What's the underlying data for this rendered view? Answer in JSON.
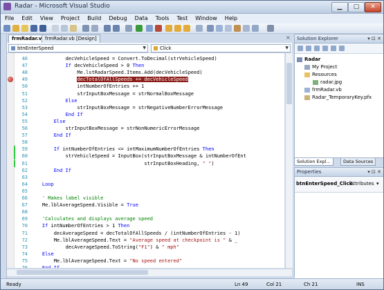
{
  "window": {
    "title": "Radar - Microsoft Visual Studio",
    "minimize": "▁",
    "maximize": "▢",
    "close": "✕"
  },
  "menu": [
    "File",
    "Edit",
    "View",
    "Project",
    "Build",
    "Debug",
    "Data",
    "Tools",
    "Test",
    "Window",
    "Help"
  ],
  "tabs": {
    "active": "frmRadar.vb",
    "inactive": "frmRadar.vb [Design]",
    "close": "×"
  },
  "dropdowns": {
    "object": "btnEnterSpeed",
    "event": "Click"
  },
  "code_lines": [
    {
      "n": "46",
      "parts": [
        {
          "t": "            decVehicleSpeed = Convert.ToDecimal(strVehicleSpeed)"
        }
      ]
    },
    {
      "n": "47",
      "parts": [
        {
          "t": "            ",
          "c": ""
        },
        {
          "t": "If",
          "c": "kw"
        },
        {
          "t": " decVehicleSpeed > 0 "
        },
        {
          "t": "Then",
          "c": "kw"
        }
      ]
    },
    {
      "n": "48",
      "parts": [
        {
          "t": "                Me.lstRadarSpeed.Items.Add(decVehicleSpeed)"
        }
      ]
    },
    {
      "n": "49",
      "parts": [
        {
          "t": "                "
        },
        {
          "t": "decTotalOfAllSpeeds += decVehicleSpeed",
          "c": "bpline"
        }
      ]
    },
    {
      "n": "50",
      "parts": [
        {
          "t": "                intNumberOfEntries += 1"
        }
      ]
    },
    {
      "n": "51",
      "parts": [
        {
          "t": "                strInputBoxMessage = strNormalBoxMessage"
        }
      ]
    },
    {
      "n": "52",
      "parts": [
        {
          "t": "            "
        },
        {
          "t": "Else",
          "c": "kw"
        }
      ]
    },
    {
      "n": "53",
      "parts": [
        {
          "t": "                strInputBoxMessage = strNegativeNumberErrorMessage"
        }
      ]
    },
    {
      "n": "54",
      "parts": [
        {
          "t": "            "
        },
        {
          "t": "End If",
          "c": "kw"
        }
      ]
    },
    {
      "n": "55",
      "parts": [
        {
          "t": "        "
        },
        {
          "t": "Else",
          "c": "kw"
        }
      ]
    },
    {
      "n": "56",
      "parts": [
        {
          "t": "            strInputBoxMessage = strNonNumericErrorMessage"
        }
      ]
    },
    {
      "n": "57",
      "parts": [
        {
          "t": "        "
        },
        {
          "t": "End If",
          "c": "kw"
        }
      ]
    },
    {
      "n": "58",
      "parts": [
        {
          "t": ""
        }
      ]
    },
    {
      "n": "59",
      "parts": [
        {
          "t": "        "
        },
        {
          "t": "If",
          "c": "kw"
        },
        {
          "t": " intNumberOfEntries <= intMaximumNumberOfEntries "
        },
        {
          "t": "Then",
          "c": "kw"
        }
      ]
    },
    {
      "n": "60",
      "parts": [
        {
          "t": "            strVehicleSpeed = InputBox(strInputBoxMessage & intNumberOfEnt"
        }
      ]
    },
    {
      "n": "61",
      "parts": [
        {
          "t": "                                       strInputBoxHeading, "
        },
        {
          "t": "\" \"",
          "c": "st"
        },
        {
          "t": ")"
        }
      ]
    },
    {
      "n": "62",
      "parts": [
        {
          "t": "        "
        },
        {
          "t": "End If",
          "c": "kw"
        }
      ]
    },
    {
      "n": "63",
      "parts": [
        {
          "t": ""
        }
      ]
    },
    {
      "n": "64",
      "parts": [
        {
          "t": "    "
        },
        {
          "t": "Loop",
          "c": "kw"
        }
      ]
    },
    {
      "n": "65",
      "parts": [
        {
          "t": ""
        }
      ]
    },
    {
      "n": "66",
      "parts": [
        {
          "t": "    "
        },
        {
          "t": "' Makes label visible",
          "c": "cm"
        }
      ]
    },
    {
      "n": "67",
      "parts": [
        {
          "t": "    Me.lblAverageSpeed.Visible = "
        },
        {
          "t": "True",
          "c": "kw"
        }
      ]
    },
    {
      "n": "68",
      "parts": [
        {
          "t": ""
        }
      ]
    },
    {
      "n": "69",
      "parts": [
        {
          "t": "    "
        },
        {
          "t": "'Calculates and displays average speed",
          "c": "cm"
        }
      ]
    },
    {
      "n": "70",
      "parts": [
        {
          "t": "    "
        },
        {
          "t": "If",
          "c": "kw"
        },
        {
          "t": " intNumberOfEntries > 1 "
        },
        {
          "t": "Then",
          "c": "kw"
        }
      ]
    },
    {
      "n": "71",
      "parts": [
        {
          "t": "        decAverageSpeed = decTotalOfAllSpeeds / (intNumberOfEntries - 1)"
        }
      ]
    },
    {
      "n": "72",
      "parts": [
        {
          "t": "        Me.lblAverageSpeed.Text = "
        },
        {
          "t": "\"Average speed at checkpoint is \"",
          "c": "st"
        },
        {
          "t": " & _"
        }
      ]
    },
    {
      "n": "73",
      "parts": [
        {
          "t": "            decAverageSpeed.ToString("
        },
        {
          "t": "\"F1\"",
          "c": "st"
        },
        {
          "t": ") & "
        },
        {
          "t": "\" mph\"",
          "c": "st"
        }
      ]
    },
    {
      "n": "74",
      "parts": [
        {
          "t": "    "
        },
        {
          "t": "Else",
          "c": "kw"
        }
      ]
    },
    {
      "n": "75",
      "parts": [
        {
          "t": "        Me.lblAverageSpeed.Text = "
        },
        {
          "t": "\"No speed entered\"",
          "c": "st"
        }
      ]
    },
    {
      "n": "76",
      "parts": [
        {
          "t": "    "
        },
        {
          "t": "End If",
          "c": "kw"
        }
      ]
    }
  ],
  "solution_explorer": {
    "title": "Solution Explorer",
    "pin": "▾ ⊡ ✕",
    "items": [
      {
        "label": "Radar",
        "bold": true
      },
      {
        "label": "My Project"
      },
      {
        "label": "Resources"
      },
      {
        "label": "radar.jpg"
      },
      {
        "label": "frmRadar.vb"
      },
      {
        "label": "Radar_TemporaryKey.pfx"
      }
    ]
  },
  "panel_tabs": {
    "solution": "Solution Expl...",
    "data": "Data Sources"
  },
  "properties": {
    "title": "Properties",
    "pin": "▾ ⊡ ✕",
    "object": "btnEnterSpeed_Click",
    "attributes": "Attributes"
  },
  "status": {
    "state": "Ready",
    "ln": "Ln 49",
    "col": "Col 21",
    "ch": "Ch 21",
    "mode": "INS"
  },
  "colors": {
    "breakpoint": "#8c1d18",
    "keyword": "#0000ff",
    "comment": "#008000",
    "string": "#a31515",
    "line_number": "#2b91af"
  }
}
